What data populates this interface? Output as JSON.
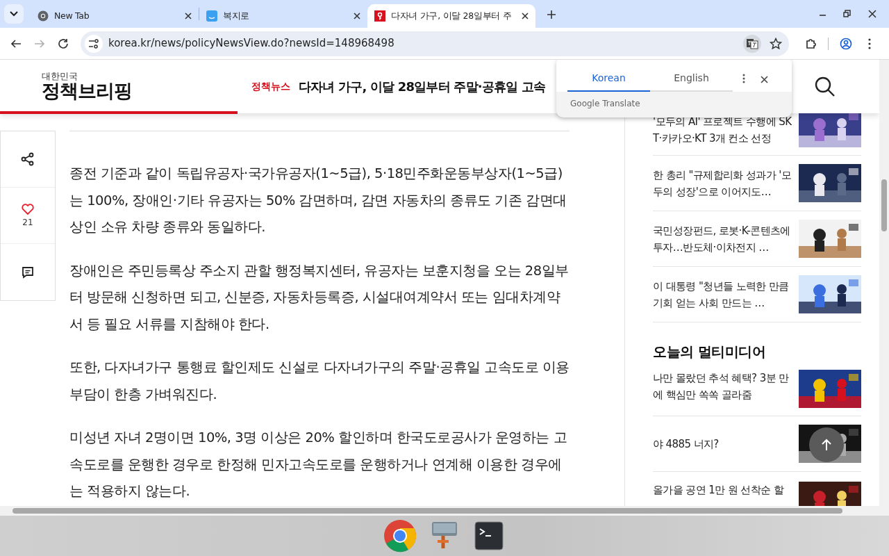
{
  "browser": {
    "tabs": [
      {
        "title": "New Tab",
        "selected": false
      },
      {
        "title": "복지로",
        "selected": false
      },
      {
        "title": "다자녀 가구, 이달 28일부터 주",
        "selected": true
      }
    ],
    "address": "korea.kr/news/policyNewsView.do?newsId=148968498",
    "forward_disabled": true
  },
  "translate_popup": {
    "tabs": [
      {
        "label": "Korean",
        "selected": true
      },
      {
        "label": "English",
        "selected": false
      }
    ],
    "footer": "Google Translate"
  },
  "site": {
    "logo_small": "대한민국",
    "logo_main": "정책브리핑",
    "category": "정책뉴스",
    "headline": "다자녀 가구, 이달 28일부터 주말·공휴일 고속",
    "reading_progress": {
      "level": 0.27
    }
  },
  "actions": [
    {
      "kind": "share"
    },
    {
      "kind": "like",
      "count": "21"
    },
    {
      "kind": "comment"
    }
  ],
  "paragraphs": [
    "종전 기준과 같이 독립유공자·국가유공자(1~5급), 5·18민주화운동부상자(1~5급)는 100%, 장애인·기타 유공자는 50% 감면하며, 감면 자동차의 종류도 기존 감면대상인 소유 차량 종류와 동일하다.",
    "장애인은 주민등록상 주소지 관할 행정복지센터, 유공자는 보훈지청을 오는 28일부터 방문해 신청하면 되고, 신분증, 자동차등록증, 시설대여계약서 또는 임대차계약서 등 필요 서류를 지참해야 한다.",
    "또한, 다자녀가구 통행료 할인제도 신설로 다자녀가구의 주말·공휴일 고속도로 이용 부담이 한층 가벼워진다.",
    "미성년 자녀 2명이면 10%, 3명 이상은 20% 할인하며 한국도로공사가 운영하는 고속도로를 운행한 경우로 한정해 민자고속도로를 운행하거나 연계해 이용한 경우에는 적용하지 않는다."
  ],
  "news": [
    {
      "title": "'모두의 AI' 프로젝트 수행에 SKT·카카오·KT 3개 컨소 선정"
    },
    {
      "title": "한 총리 \"규제합리화 성과가 '모두의 성장'으로 이어지도…"
    },
    {
      "title": "국민성장펀드, 로봇·K-콘텐츠에 투자…반도체·이차전지 …"
    },
    {
      "title": "이 대통령 \"청년들 노력한 만큼 기회 얻는 사회 만드는 …"
    }
  ],
  "multimedia_title": "오늘의 멀티미디어",
  "multimedia": [
    {
      "title": "나만 몰랐던 추석 혜택? 3분 만에 핵심만 쏙쏙 골라줌"
    },
    {
      "title": "야 4885 너지?"
    },
    {
      "title": "올가을 공연 1만 원 선착순 할"
    }
  ]
}
